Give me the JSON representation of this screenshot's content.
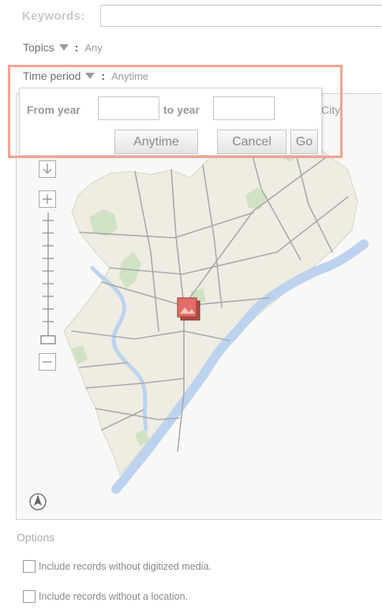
{
  "search": {
    "keywords_label": "Keywords:",
    "keywords_value": ""
  },
  "filters": {
    "topics_label": "Topics",
    "topics_value": "Any",
    "colon": ":",
    "time_label": "Time period",
    "time_value": "Anytime"
  },
  "popup": {
    "from_label": "From year",
    "from_value": "",
    "to_label": "to year",
    "to_value": "",
    "anytime_button": "Anytime",
    "cancel_button": "Cancel",
    "go_button": "Go"
  },
  "map": {
    "city_label_fragment": "City",
    "icons": [
      "pan-down-icon",
      "zoom-in-icon",
      "zoom-slider",
      "zoom-out-icon",
      "compass-icon",
      "photo-marker-icon"
    ],
    "colors": {
      "land": "#efece2",
      "water": "#bcd3ef",
      "park": "#cfe3c4",
      "road": "#a9a9a9",
      "marker": "#d9534f"
    }
  },
  "options": {
    "heading": "Options",
    "item1": "Include records without digitized media.",
    "item2": "Include records without a location."
  },
  "highlight_color": "#f2a293"
}
